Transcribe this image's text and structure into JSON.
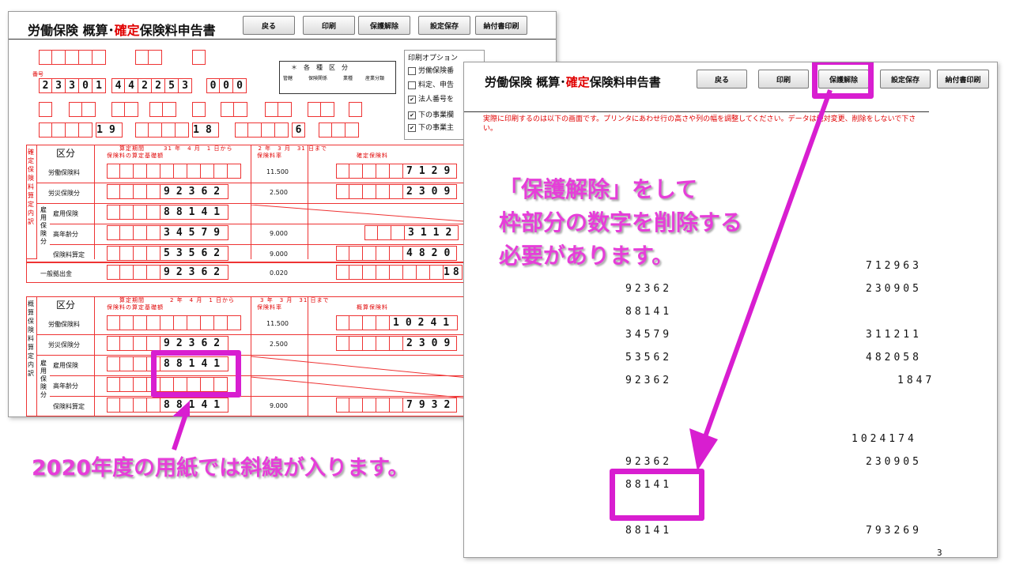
{
  "back_window": {
    "title_pre": "労働保険 概算･",
    "title_red": "確定",
    "title_post": "保険料申告書",
    "buttons": [
      "戻る",
      "印刷",
      "保護解除",
      "設定保存",
      "納付書印刷"
    ],
    "number_row": [
      "2",
      "3",
      "3",
      "0",
      "1",
      "4",
      "4",
      "2",
      "2",
      "5",
      "3",
      "0",
      "0",
      "0"
    ],
    "row3_digits": {
      "a": "19",
      "b": "18",
      "c": "6"
    },
    "category_title": "＊　各　種　区　分",
    "category_cols": [
      "管轄",
      "保険関係",
      "業種",
      "産業分類"
    ],
    "print_options": {
      "title": "印刷オプション",
      "items": [
        {
          "label": "労働保険番",
          "checked": false
        },
        {
          "label": "料定、申告",
          "checked": false
        },
        {
          "label": "法人番号を",
          "checked": true
        },
        {
          "label": "下の事業欄",
          "checked": true
        },
        {
          "label": "下の事業主",
          "checked": true
        }
      ]
    },
    "section1": {
      "kubun": "区分",
      "side_label": "確定保険料算定内訳",
      "period_header": "算定期間　　　31 年　4 月　1 日から　　　　2 年　3 月　31 日まで",
      "col_headers": [
        "保険料の算定基礎額",
        "保険料率",
        "確定保険料"
      ],
      "rows": [
        {
          "label": "労働保険料",
          "base": "",
          "rate": "11.500",
          "premium": "7129"
        },
        {
          "label": "労災保険分",
          "base": "92362",
          "rate": "2.500",
          "premium": "2309"
        },
        {
          "label": "雇用保険",
          "base": "88141",
          "rate": "",
          "premium": ""
        },
        {
          "label": "高年齢分",
          "base": "34579",
          "rate": "9.000",
          "premium": "3112"
        },
        {
          "label": "保険料算定",
          "base": "53562",
          "rate": "9.000",
          "premium": "4820"
        },
        {
          "label": "一般拠出金",
          "base": "92362",
          "rate": "0.020",
          "premium": "18"
        }
      ],
      "sub_labels": [
        "雇用保険分"
      ]
    },
    "section2": {
      "kubun": "区分",
      "side_label": "概算保険料算定内訳",
      "period_header": "算定期間　　　　2 年　4 月　1 日から　　　　3 年　3 月　31 日まで",
      "col_headers": [
        "保険料の算定基礎額",
        "保険料率",
        "概算保険料"
      ],
      "rows": [
        {
          "label": "労働保険料",
          "base": "",
          "rate": "11.500",
          "premium": "10241"
        },
        {
          "label": "労災保険分",
          "base": "92362",
          "rate": "2.500",
          "premium": "2309"
        },
        {
          "label": "雇用保険",
          "base": "88141",
          "rate": "",
          "premium": ""
        },
        {
          "label": "高年齢分",
          "base": "",
          "rate": "",
          "premium": ""
        },
        {
          "label": "保険料算定",
          "base": "88141",
          "rate": "9.000",
          "premium": "7932"
        }
      ]
    }
  },
  "front_window": {
    "title_pre": "労働保険 概算･",
    "title_red": "確定",
    "title_post": "保険料申告書",
    "buttons": [
      "戻る",
      "印刷",
      "保護解除",
      "設定保存",
      "納付書印刷"
    ],
    "notice": "実際に印刷するのは以下の画面です。プリンタにあわせ行の高さや列の幅を調整してください。データは絶対変更、削除をしないで下さい。",
    "values_left": [
      "92362",
      "88141",
      "34579",
      "53562",
      "92362",
      "92362",
      "88141",
      "88141"
    ],
    "values_right": [
      "712963",
      "230905",
      "311211",
      "482058",
      "1847",
      "1024174",
      "230905",
      "793269",
      "3"
    ]
  },
  "callouts": {
    "protect": "「保護解除」をして\n枠部分の数字を削除する\n必要があります。",
    "diagonal": "2020年度の用紙では斜線が入ります。"
  },
  "colors": {
    "magenta": "#d81ed0",
    "accent_red": "#e00000"
  }
}
